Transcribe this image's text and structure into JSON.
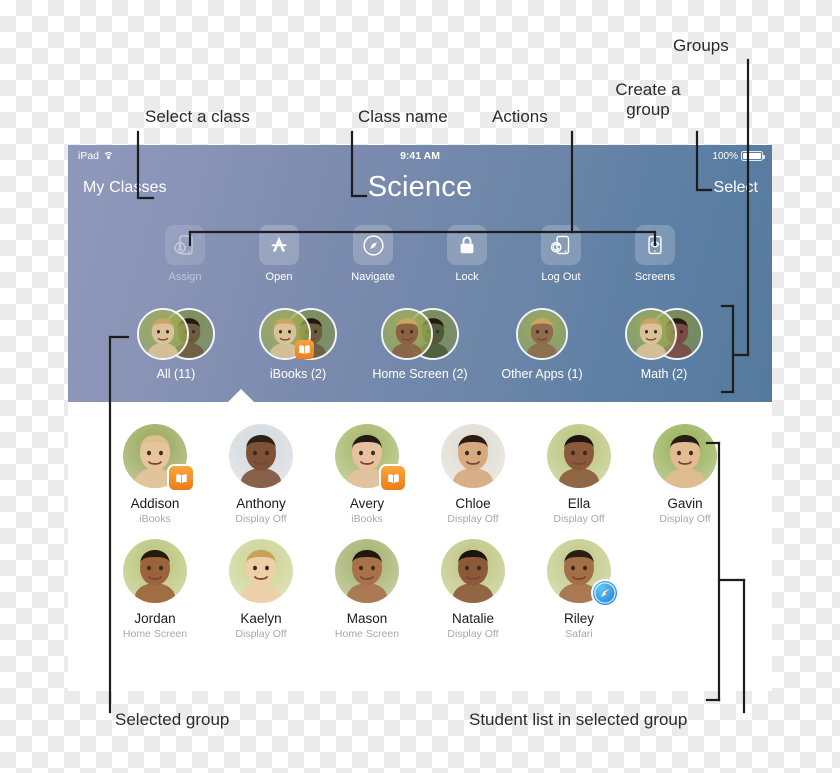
{
  "statusbar": {
    "device": "iPad",
    "wifi_icon": "wifi-icon",
    "time": "9:41 AM",
    "battery_pct": "100%",
    "battery_icon": "battery-icon"
  },
  "header": {
    "back_label": "My Classes",
    "title": "Science",
    "select_label": "Select",
    "gradient_from": "#8f99bb",
    "gradient_to": "#56799e"
  },
  "toolbar": {
    "items": [
      {
        "label": "Assign",
        "icon": "assign-icon",
        "disabled": true
      },
      {
        "label": "Open",
        "icon": "appstore-icon",
        "disabled": false
      },
      {
        "label": "Navigate",
        "icon": "compass-icon",
        "disabled": false
      },
      {
        "label": "Lock",
        "icon": "lock-icon",
        "disabled": false
      },
      {
        "label": "Log Out",
        "icon": "logout-icon",
        "disabled": false
      },
      {
        "label": "Screens",
        "icon": "eye-screen-icon",
        "disabled": false
      }
    ]
  },
  "groups": {
    "items": [
      {
        "label": "All (11)",
        "selected": true,
        "badge": null,
        "stack": 2,
        "colors": [
          "#d9c29a",
          "#6e5c41"
        ]
      },
      {
        "label": "iBooks (2)",
        "selected": false,
        "badge": "ibooks",
        "stack": 2,
        "colors": [
          "#d9c29a",
          "#6e5c41"
        ]
      },
      {
        "label": "Home Screen (2)",
        "selected": false,
        "badge": null,
        "stack": 2,
        "colors": [
          "#8a6242",
          "#4d5b3a"
        ]
      },
      {
        "label": "Other Apps (1)",
        "selected": false,
        "badge": null,
        "stack": 1,
        "colors": [
          "#8d6b4c",
          "#8d6b4c"
        ]
      },
      {
        "label": "Math (2)",
        "selected": false,
        "badge": null,
        "stack": 2,
        "colors": [
          "#d9c29a",
          "#7a4b44"
        ]
      }
    ]
  },
  "students": [
    {
      "name": "Addison",
      "status": "iBooks",
      "badge": "ibooks",
      "skin": "#e8c49c",
      "hair": "#d9c18b",
      "bg": "#8fa04d"
    },
    {
      "name": "Anthony",
      "status": "Display Off",
      "badge": null,
      "skin": "#7d5236",
      "hair": "#2e2118",
      "bg": "#cfd6db"
    },
    {
      "name": "Avery",
      "status": "iBooks",
      "badge": "ibooks",
      "skin": "#e6c2a0",
      "hair": "#241a13",
      "bg": "#9db05a"
    },
    {
      "name": "Chloe",
      "status": "Display Off",
      "badge": null,
      "skin": "#d7a97e",
      "hair": "#2b1c14",
      "bg": "#dcd9cf"
    },
    {
      "name": "Ella",
      "status": "Display Off",
      "badge": null,
      "skin": "#8a5a3b",
      "hair": "#1d1410",
      "bg": "#b5bf71"
    },
    {
      "name": "Gavin",
      "status": "Display Off",
      "badge": null,
      "skin": "#e2bb91",
      "hair": "#271c14",
      "bg": "#8fa94a"
    },
    {
      "name": "Jordan",
      "status": "Home Screen",
      "badge": null,
      "skin": "#9c6239",
      "hair": "#241a12",
      "bg": "#b4bf6e"
    },
    {
      "name": "Kaelyn",
      "status": "Display Off",
      "badge": null,
      "skin": "#edcfa8",
      "hair": "#c8a05a",
      "bg": "#c8cf8a"
    },
    {
      "name": "Mason",
      "status": "Home Screen",
      "badge": null,
      "skin": "#a9714a",
      "hair": "#20170f",
      "bg": "#9cab63"
    },
    {
      "name": "Natalie",
      "status": "Display Off",
      "badge": null,
      "skin": "#8c5a38",
      "hair": "#1b1410",
      "bg": "#b9c077"
    },
    {
      "name": "Riley",
      "status": "Safari",
      "badge": "safari",
      "skin": "#a46f47",
      "hair": "#2a1d14",
      "bg": "#bcc57f"
    }
  ],
  "annotations": [
    {
      "id": "select-a-class",
      "text": "Select a class"
    },
    {
      "id": "class-name",
      "text": "Class name"
    },
    {
      "id": "actions",
      "text": "Actions"
    },
    {
      "id": "create-a-group",
      "text": "Create a\ngroup",
      "line1": "Create a",
      "line2": "group"
    },
    {
      "id": "groups",
      "text": "Groups"
    },
    {
      "id": "selected-group",
      "text": "Selected group"
    },
    {
      "id": "student-list",
      "text": "Student list in selected group"
    }
  ]
}
